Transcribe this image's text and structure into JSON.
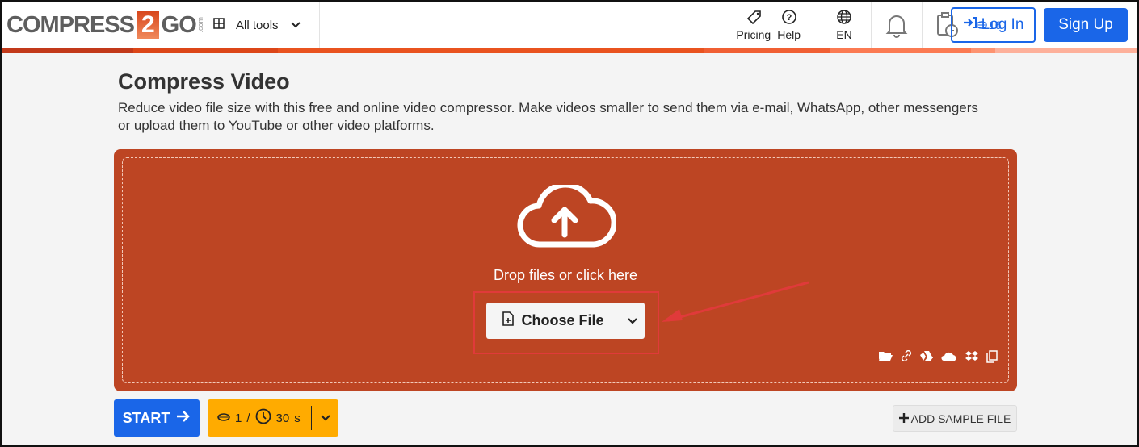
{
  "header": {
    "logo_text": "COMPRESS",
    "logo_num": "2",
    "logo_go": "GO",
    "logo_com": ".com",
    "all_tools": "All tools",
    "pricing": "Pricing",
    "help": "Help",
    "lang": "EN",
    "credits": "16",
    "login": "Log In",
    "signup": "Sign Up"
  },
  "main": {
    "title": "Compress Video",
    "description": "Reduce video file size with this free and online video compressor. Make videos smaller to send them via e-mail, WhatsApp, other messengers or upload them to YouTube or other video platforms.",
    "drop_text": "Drop files or click here",
    "choose_file": "Choose File"
  },
  "footer": {
    "start": "START",
    "credit_cost": "1",
    "slash": "/",
    "time": "30",
    "time_unit": "s",
    "add_sample": "ADD SAMPLE FILE"
  },
  "colors": {
    "accent": "#bd4523",
    "primary": "#1a66e8",
    "credit": "#ffab00",
    "annotation": "#e03a3a"
  }
}
